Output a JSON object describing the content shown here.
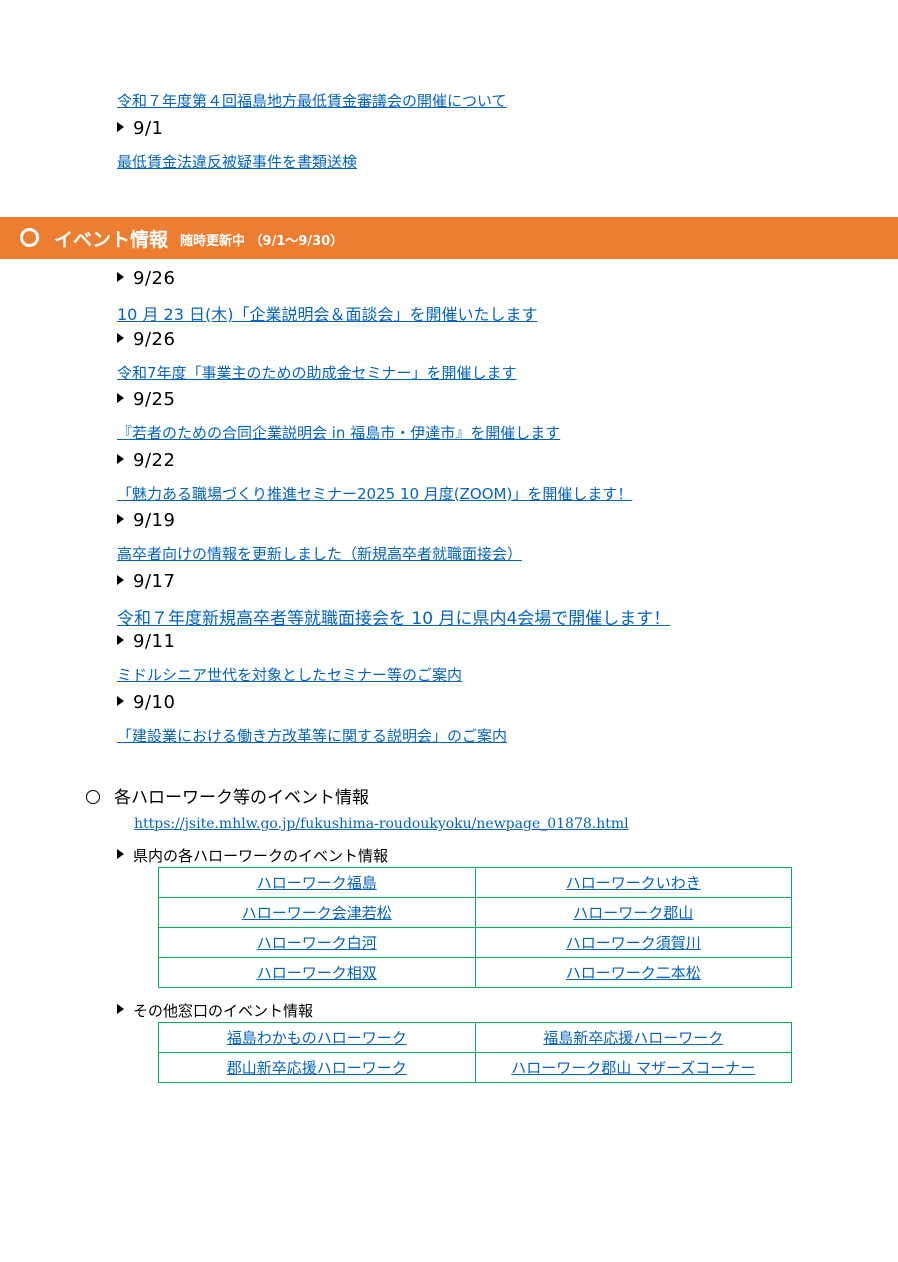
{
  "top": {
    "link1": "令和７年度第４回福島地方最低賃金審議会の開催について",
    "date1": "9/1",
    "link2": "最低賃金法違反被疑事件を書類送検"
  },
  "banner": {
    "title": "イベント情報",
    "subtitle": "随時更新中 （9/1～9/30）",
    "color": "#ed7d31"
  },
  "events": [
    {
      "date": "9/26",
      "text": "10 月 23 日(木)「企業説明会＆面談会」を開催いたします"
    },
    {
      "date": "9/26",
      "text": "令和7年度「事業主のための助成金セミナー」を開催します"
    },
    {
      "date": "9/25",
      "text": "『若者のための合同企業説明会 in 福島市・伊達市』を開催します"
    },
    {
      "date": "9/22",
      "text": "「魅力ある職場づくり推進セミナー2025 10 月度(ZOOM)」を開催します！"
    },
    {
      "date": "9/19",
      "text": "高卒者向けの情報を更新しました（新規高卒者就職面接会）"
    },
    {
      "date": "9/17",
      "text": "令和７年度新規高卒者等就職面接会を 10 月に県内4会場で開催します！"
    },
    {
      "date": "9/11",
      "text": "ミドルシニア世代を対象としたセミナー等のご案内"
    },
    {
      "date": "9/10",
      "text": "「建設業における働き方改革等に関する説明会」のご案内"
    }
  ],
  "hellowork": {
    "heading": "各ハローワーク等のイベント情報",
    "url": "https://jsite.mhlw.go.jp/fukushima-roudoukyoku/newpage_01878.html",
    "sub1": "県内の各ハローワークのイベント情報",
    "table1": [
      [
        "ハローワーク福島",
        "ハローワークいわき"
      ],
      [
        "ハローワーク会津若松",
        "ハローワーク郡山"
      ],
      [
        "ハローワーク白河",
        "ハローワーク須賀川"
      ],
      [
        "ハローワーク相双",
        "ハローワーク二本松"
      ]
    ],
    "sub2": "その他窓口のイベント情報",
    "table2": [
      [
        "福島わかものハローワーク",
        "福島新卒応援ハローワーク"
      ],
      [
        "郡山新卒応援ハローワーク",
        "ハローワーク郡山 マザーズコーナー"
      ]
    ],
    "border_color": "#00b050",
    "link_color": "#0563c1"
  }
}
